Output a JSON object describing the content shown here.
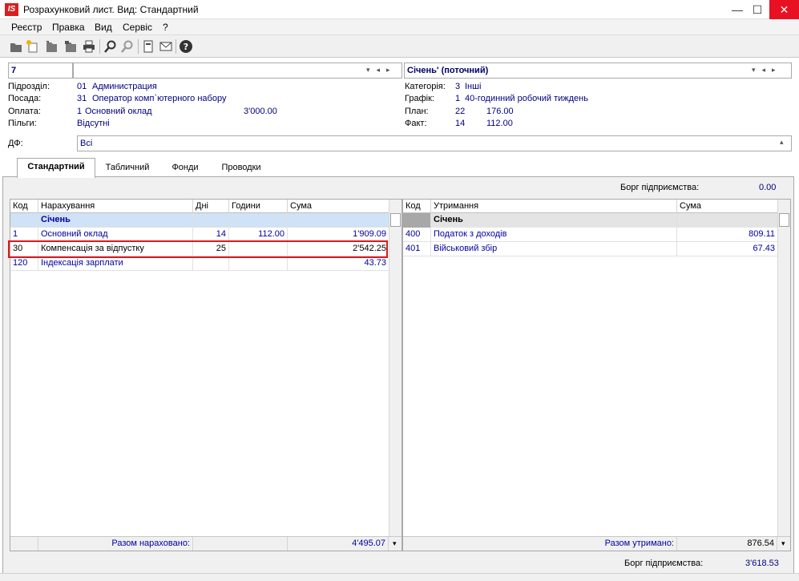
{
  "window": {
    "logo": "IS",
    "title": "Розрахунковий лист. Вид: Стандартний",
    "minimize": "—",
    "maximize": "☐",
    "close": "✕"
  },
  "menu": [
    "Реєстр",
    "Правка",
    "Вид",
    "Сервіс",
    "?"
  ],
  "toolbar": {
    "icons": [
      "new-doc-icon",
      "new-star-icon",
      "edit-icon",
      "copy-icon",
      "print-icon",
      "search-icon",
      "filter-icon",
      "document-icon",
      "mail-icon",
      "help-icon"
    ]
  },
  "header": {
    "employee_code": "7",
    "period": "Січень' (поточний)",
    "left": [
      {
        "label": "Підрозділ:",
        "code": "01",
        "value": "Администрация",
        "extra": ""
      },
      {
        "label": "Посада:",
        "code": "31",
        "value": "Оператор комп`ютерного набору",
        "extra": ""
      },
      {
        "label": "Оплата:",
        "code": "1",
        "value": "Основний оклад",
        "extra": "3'000.00"
      },
      {
        "label": "Пільги:",
        "code": "",
        "value": "Відсутні",
        "extra": ""
      }
    ],
    "right": [
      {
        "label": "Категорія:",
        "code": "3",
        "value": "Інші"
      },
      {
        "label": "Графік:",
        "code": "1",
        "value": "40-годинний робочий тиждень"
      },
      {
        "label": "План:",
        "code": "22",
        "value": "176.00"
      },
      {
        "label": "Факт:",
        "code": "14",
        "value": "112.00"
      }
    ],
    "df_label": "ДФ:",
    "df_value": "Всі"
  },
  "tabs": [
    "Стандартний",
    "Табличний",
    "Фонди",
    "Проводки"
  ],
  "debt_top_label": "Борг підприємства:",
  "debt_top_value": "0.00",
  "accruals": {
    "headers": [
      "Код",
      "Нарахування",
      "Дні",
      "Години",
      "Сума"
    ],
    "group": "Січень",
    "rows": [
      {
        "code": "1",
        "name": "Основний оклад",
        "days": "14",
        "hours": "112.00",
        "sum": "1'909.09"
      },
      {
        "code": "30",
        "name": "Компенсація за відпустку",
        "days": "25",
        "hours": "",
        "sum": "2'542.25"
      },
      {
        "code": "120",
        "name": "Індексація зарплати",
        "days": "",
        "hours": "",
        "sum": "43.73"
      }
    ],
    "total_label": "Разом нараховано:",
    "total_value": "4'495.07"
  },
  "deductions": {
    "headers": [
      "Код",
      "Утримання",
      "Сума"
    ],
    "group": "Січень",
    "rows": [
      {
        "code": "400",
        "name": "Податок з доходів",
        "sum": "809.11"
      },
      {
        "code": "401",
        "name": "Військовий збір",
        "sum": "67.43"
      }
    ],
    "total_label": "Разом утримано:",
    "total_value": "876.54"
  },
  "debt_bottom_label": "Борг підприємства:",
  "debt_bottom_value": "3'618.53"
}
